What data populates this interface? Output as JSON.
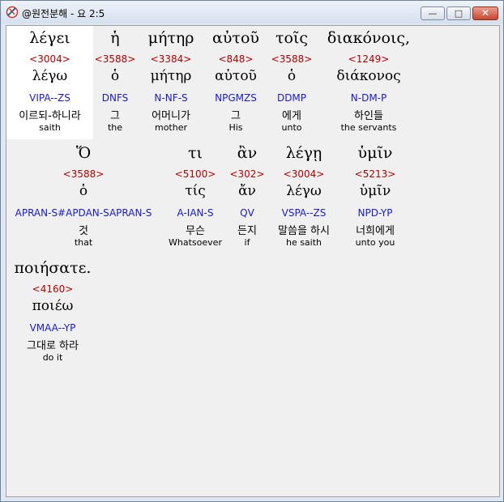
{
  "window": {
    "title": "@원전분해 - 요 2:5",
    "minimize": "—",
    "maximize": "□",
    "close": "✕"
  },
  "words": [
    {
      "greek": "λέγει",
      "strong": "<3004>",
      "lemma": "λέγω",
      "morph": "VIPA--ZS",
      "korean": "이르되-하니라",
      "english": "saith",
      "selected": true
    },
    {
      "greek": "ἡ",
      "strong": "<3588>",
      "lemma": "ὁ",
      "morph": "DNFS",
      "korean": "그",
      "english": "the"
    },
    {
      "greek": "μήτηρ",
      "strong": "<3384>",
      "lemma": "μήτηρ",
      "morph": "N-NF-S",
      "korean": "어머니가",
      "english": "mother"
    },
    {
      "greek": "αὐτοῦ",
      "strong": "<848>",
      "lemma": "αὐτοῦ",
      "morph": "NPGMZS",
      "korean": "그",
      "english": "His"
    },
    {
      "greek": "τοῖς",
      "strong": "<3588>",
      "lemma": "ὁ",
      "morph": "DDMP",
      "korean": "에게",
      "english": "unto"
    },
    {
      "greek": "διακόνοις,",
      "strong": "<1249>",
      "lemma": "διάκονος",
      "morph": "N-DM-P",
      "korean": "하인들",
      "english": "the servants"
    },
    {
      "greek": "Ὅ",
      "strong": "<3588>",
      "lemma": "ὁ",
      "morph": "APRAN-S#APDAN-SAPRAN-S",
      "korean": "것",
      "english": "that"
    },
    {
      "greek": "τι",
      "strong": "<5100>",
      "lemma": "τίς",
      "morph": "A-IAN-S",
      "korean": "무슨",
      "english": "Whatsoever"
    },
    {
      "greek": "ἂν",
      "strong": "<302>",
      "lemma": "ἄν",
      "morph": "QV",
      "korean": "든지",
      "english": "if"
    },
    {
      "greek": "λέγῃ",
      "strong": "<3004>",
      "lemma": "λέγω",
      "morph": "VSPA--ZS",
      "korean": "말씀을 하시",
      "english": "he saith"
    },
    {
      "greek": "ὑμῖν",
      "strong": "<5213>",
      "lemma": "ὑμῖν",
      "morph": "NPD-YP",
      "korean": "너희에게",
      "english": "unto you"
    },
    {
      "greek": "ποιήσατε.",
      "strong": "<4160>",
      "lemma": "ποιέω",
      "morph": "VMAA--YP",
      "korean": "그대로 하라",
      "english": "do it"
    }
  ]
}
